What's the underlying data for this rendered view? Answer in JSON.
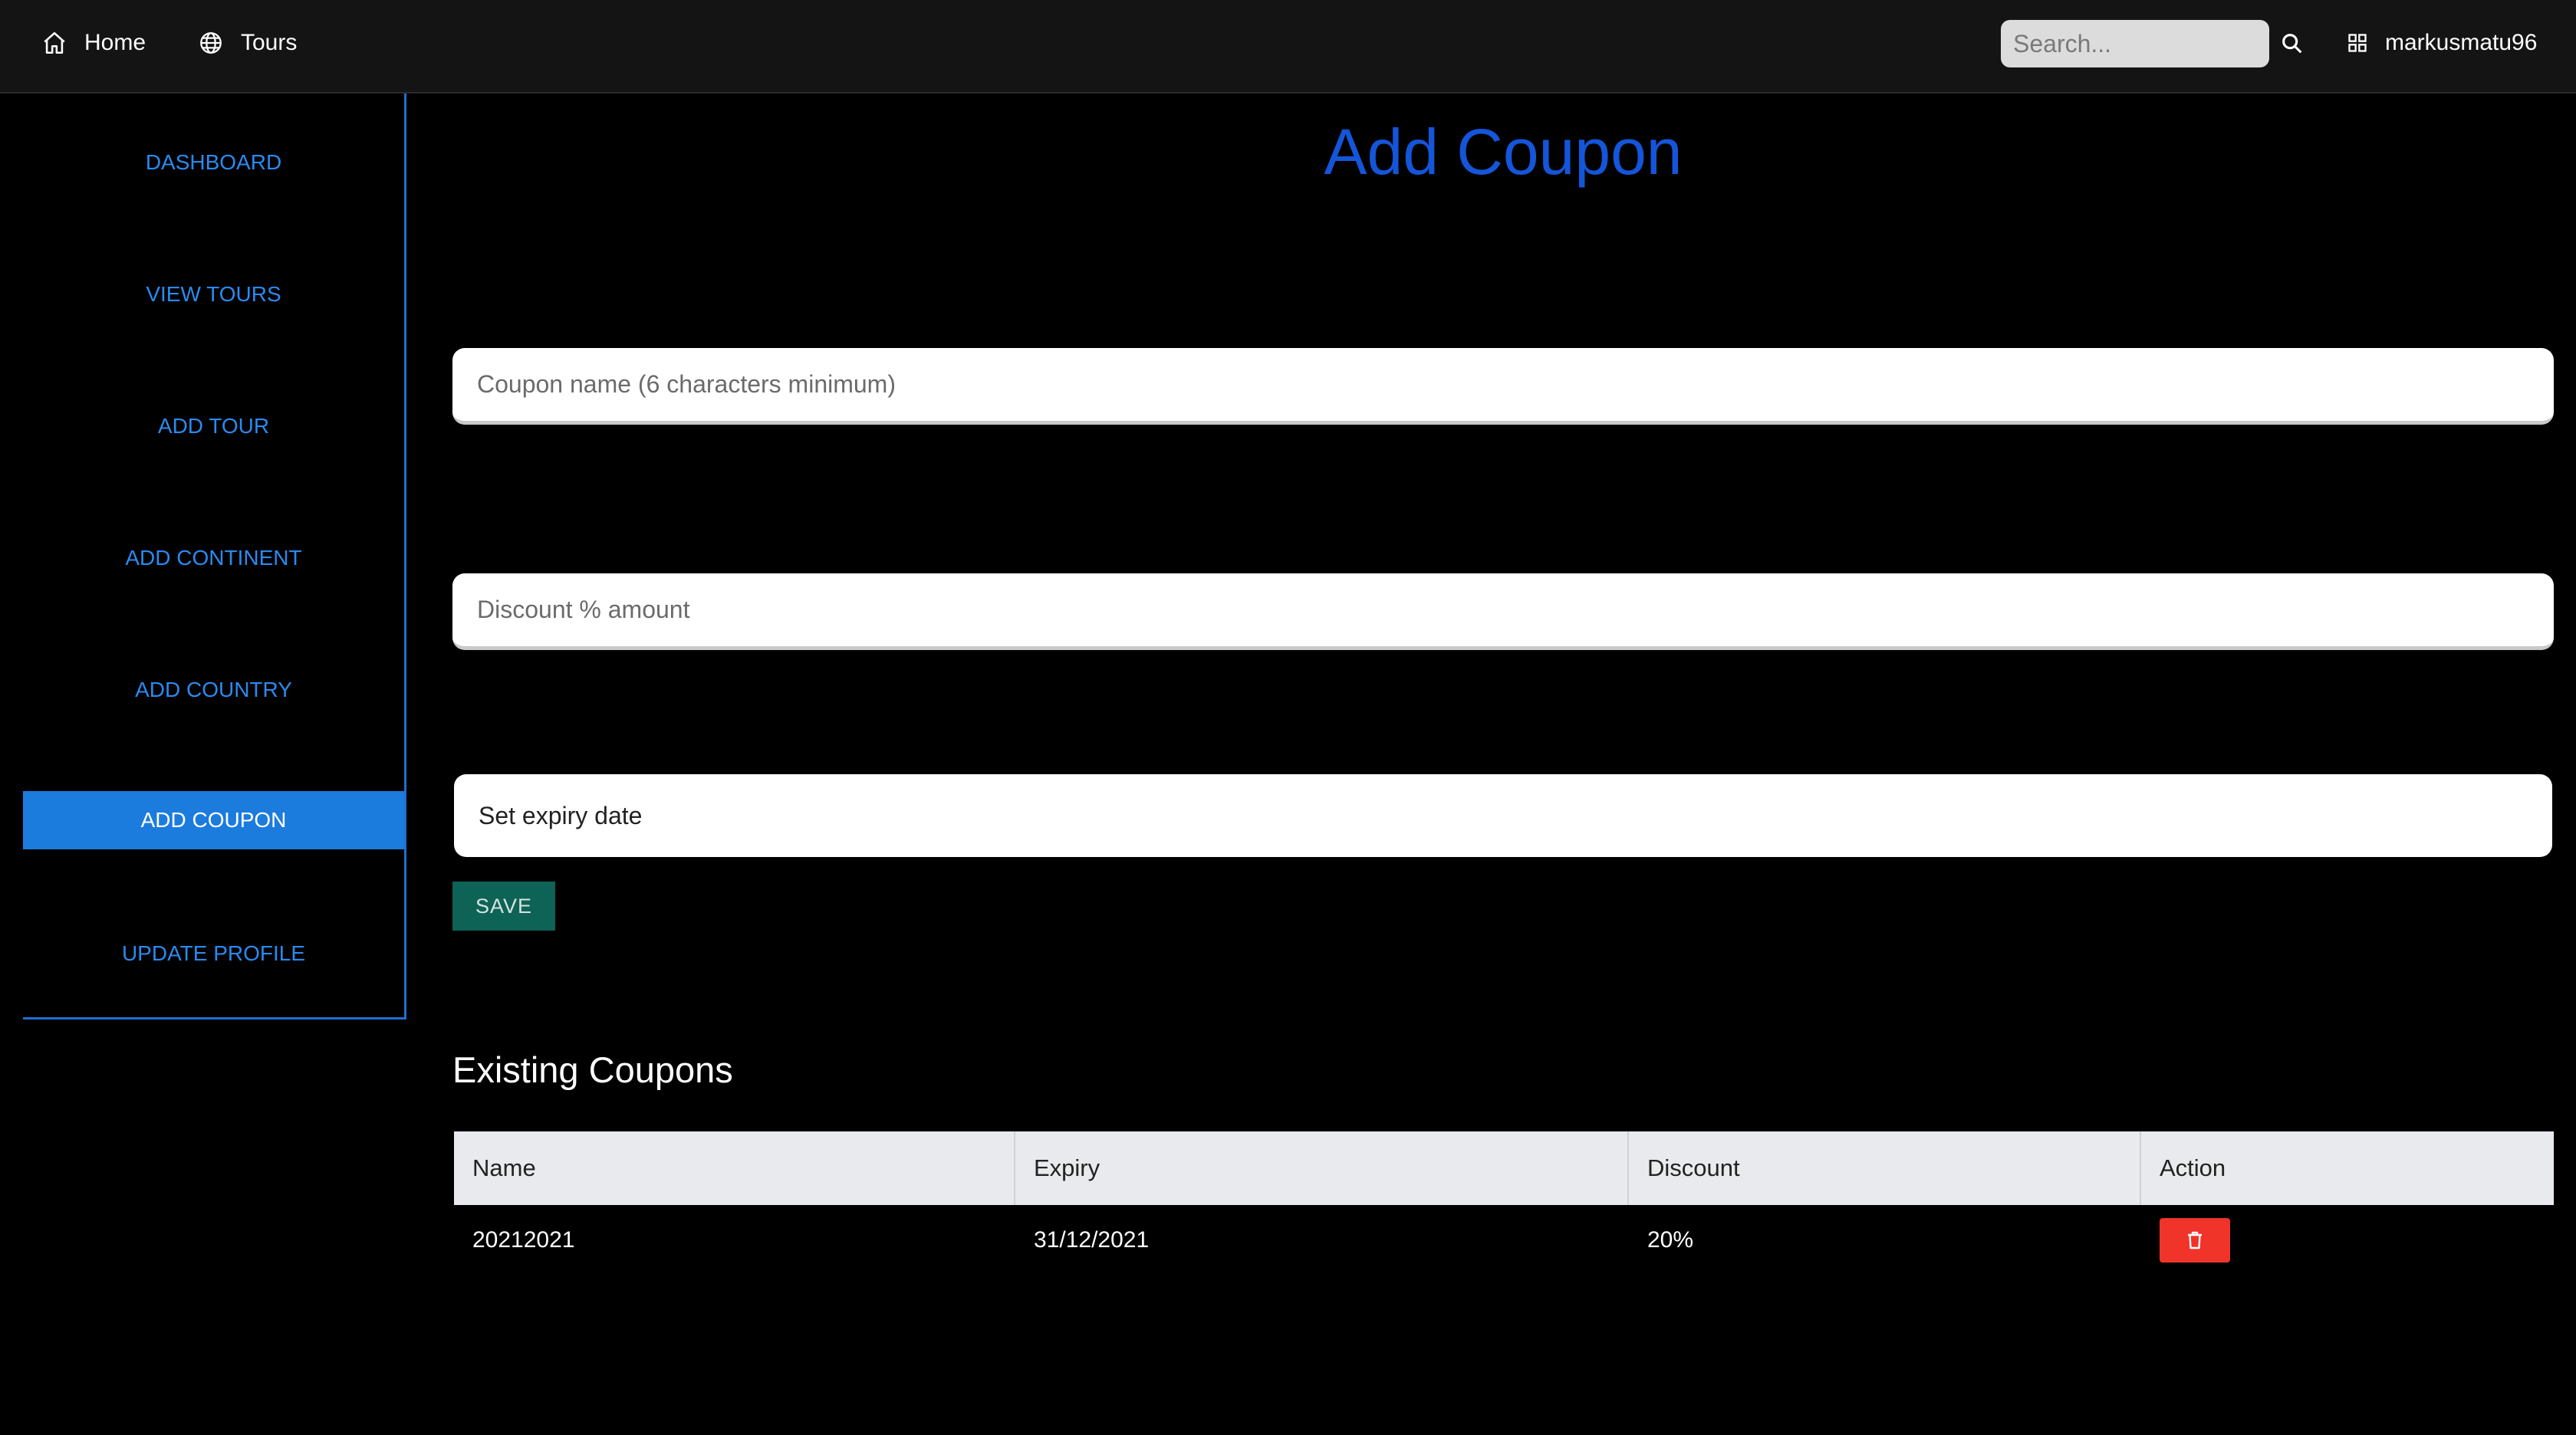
{
  "nav": {
    "home_label": "Home",
    "tours_label": "Tours",
    "search_placeholder": "Search...",
    "username": "markusmatu96",
    "icons": [
      "home-icon",
      "globe-icon",
      "search-icon",
      "grid-icon"
    ]
  },
  "sidebar": {
    "items": [
      {
        "label": "DASHBOARD",
        "active": false
      },
      {
        "label": "VIEW TOURS",
        "active": false
      },
      {
        "label": "ADD TOUR",
        "active": false
      },
      {
        "label": "ADD CONTINENT",
        "active": false
      },
      {
        "label": "ADD COUNTRY",
        "active": false
      },
      {
        "label": "ADD COUPON",
        "active": true
      },
      {
        "label": "UPDATE PROFILE",
        "active": false
      }
    ]
  },
  "main": {
    "title": "Add Coupon",
    "coupon_name_placeholder": "Coupon name (6 characters minimum)",
    "discount_placeholder": "Discount % amount",
    "expiry_label": "Set expiry date",
    "save_label": "SAVE"
  },
  "coupons": {
    "title": "Existing Coupons",
    "headers": [
      "Name",
      "Expiry",
      "Discount",
      "Action"
    ],
    "rows": [
      {
        "name": "20212021",
        "expiry": "31/12/2021",
        "discount": "20%",
        "action_icon": "trash-icon"
      }
    ]
  },
  "colors": {
    "accent_blue": "#1c7cde",
    "title_blue": "#1455d9",
    "save_green": "#0d6356",
    "delete_red": "#f0342a"
  }
}
